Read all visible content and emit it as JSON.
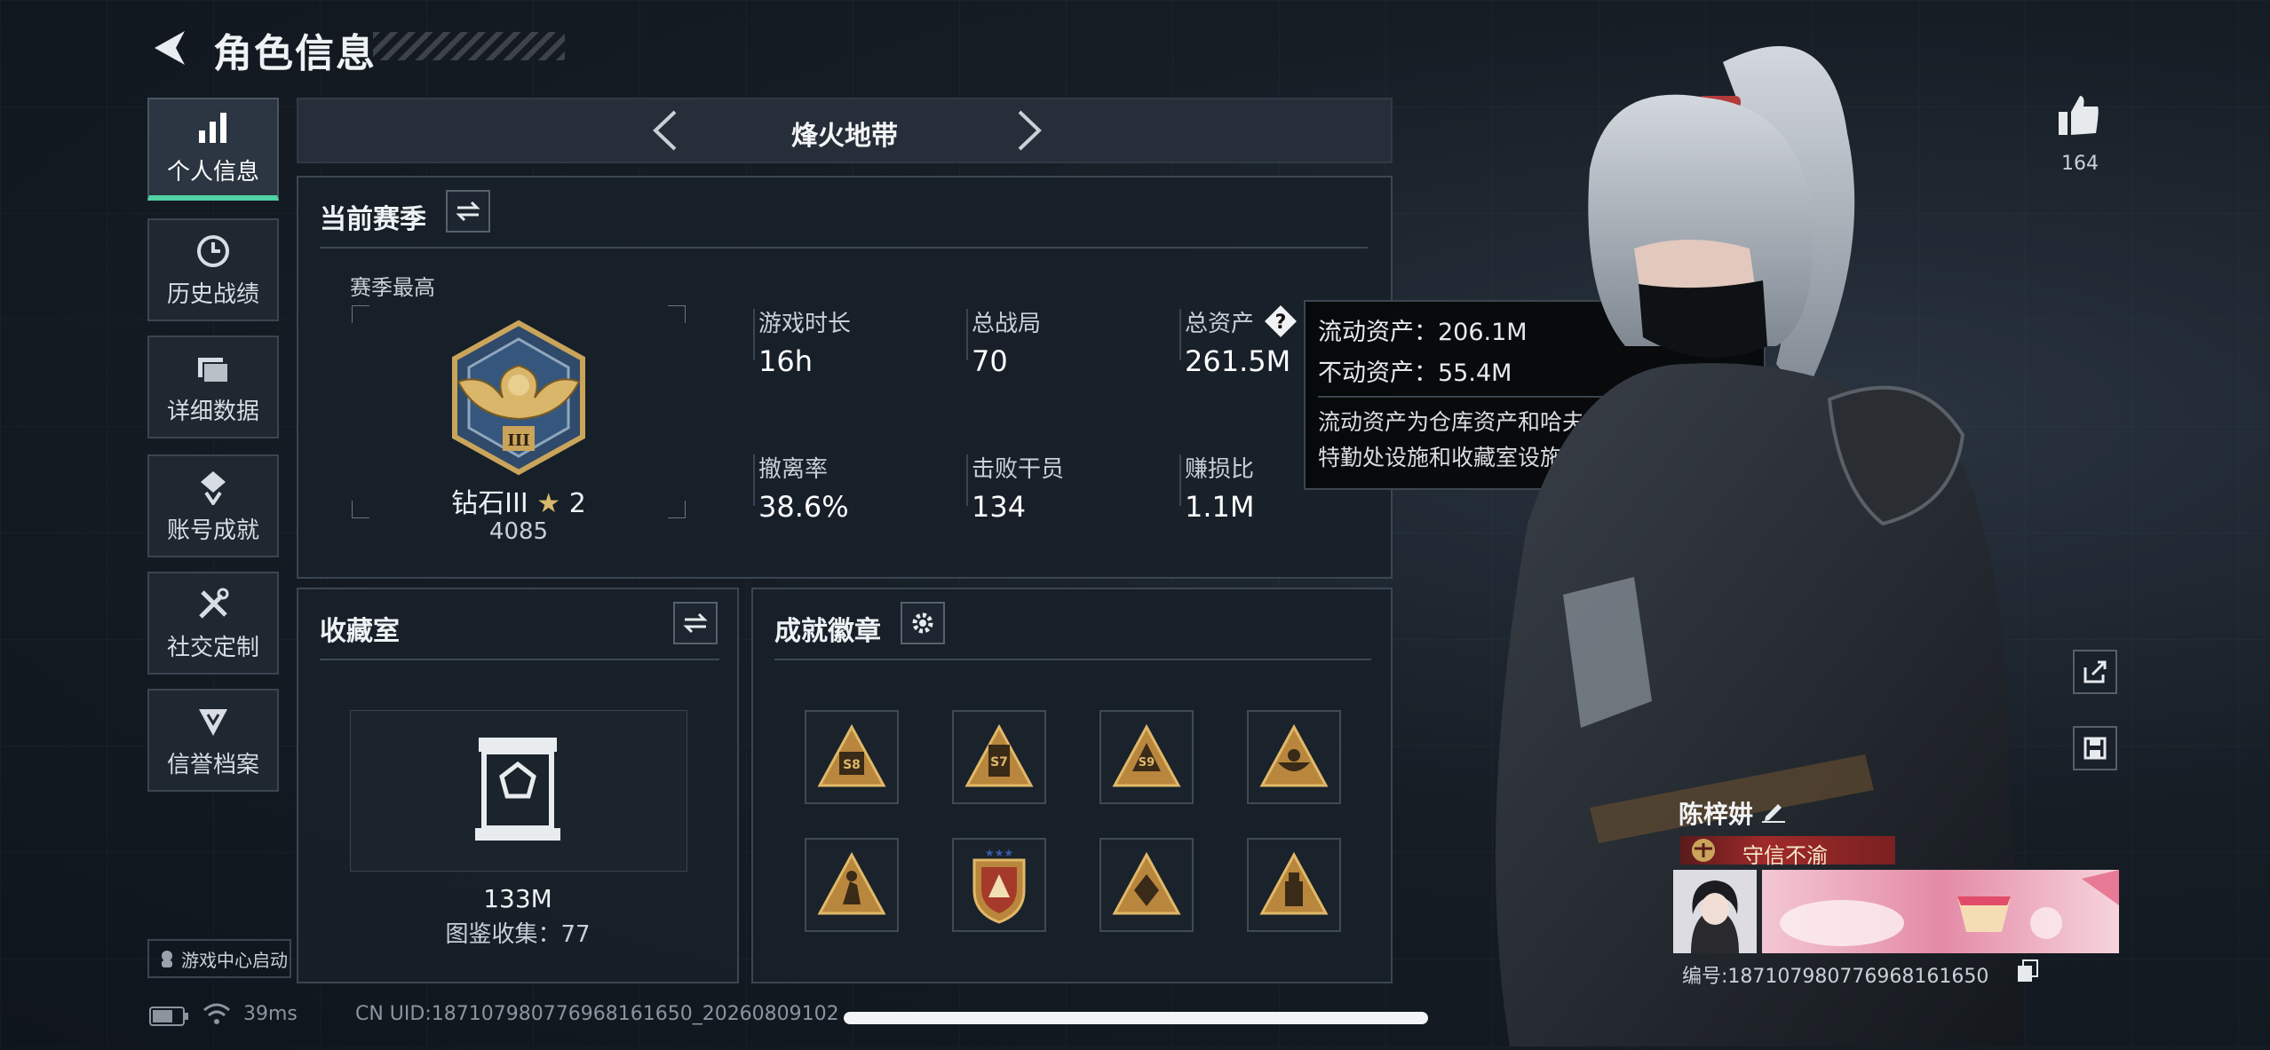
{
  "header": {
    "title": "角色信息"
  },
  "nav": [
    {
      "label": "个人信息",
      "icon": "bar-chart-icon",
      "active": true
    },
    {
      "label": "历史战绩",
      "icon": "clock-icon",
      "active": false
    },
    {
      "label": "详细数据",
      "icon": "folder-icon",
      "active": false
    },
    {
      "label": "账号成就",
      "icon": "achievement-icon",
      "active": false
    },
    {
      "label": "社交定制",
      "icon": "tools-icon",
      "active": false
    },
    {
      "label": "信誉档案",
      "icon": "shield-icon",
      "active": false
    }
  ],
  "mode": {
    "title": "烽火地带"
  },
  "season": {
    "title": "当前赛季",
    "best_label": "赛季最高",
    "rank_name": "钻石III",
    "rank_stars": "2",
    "rank_score": "4085",
    "stats": [
      {
        "label": "游戏时长",
        "value": "16h"
      },
      {
        "label": "总战局",
        "value": "70"
      },
      {
        "label": "总资产",
        "value": "261.5M"
      },
      {
        "label": "撤离率",
        "value": "38.6%"
      },
      {
        "label": "击败干员",
        "value": "134"
      },
      {
        "label": "赚损比",
        "value": "1.1M"
      }
    ]
  },
  "tooltip": {
    "liquid": "流动资产：206.1M",
    "fixed": "不动资产：55.4M",
    "desc": "流动资产为仓库资产和哈夫币，不动资产为特勤处设施和收藏室设施"
  },
  "collection": {
    "title": "收藏室",
    "value": "133M",
    "count": "图鉴收集：77"
  },
  "achievements": {
    "title": "成就徽章",
    "badges": [
      {
        "icon": "badge-s8-icon",
        "text": "S8"
      },
      {
        "icon": "badge-s7-icon",
        "text": "S7"
      },
      {
        "icon": "badge-s9-icon",
        "text": "S9"
      },
      {
        "icon": "badge-bowl-icon",
        "text": ""
      },
      {
        "icon": "badge-figure-icon",
        "text": ""
      },
      {
        "icon": "badge-crest-icon",
        "text": ""
      },
      {
        "icon": "badge-diamond-icon",
        "text": ""
      },
      {
        "icon": "badge-tower-icon",
        "text": ""
      }
    ]
  },
  "player": {
    "likes": "164",
    "name": "陈梓妌",
    "motto": "守信不渝",
    "id": "编号:18710798077696816165​0"
  },
  "footer": {
    "launch": "游戏中心启动",
    "ping": "39ms",
    "uid": "CN UID:18710798077696816165​0_20260809​1​0​2"
  },
  "colors": {
    "accent": "#4fd3a4",
    "gold": "#c9a45a",
    "motto_bg": "#8a2424"
  }
}
